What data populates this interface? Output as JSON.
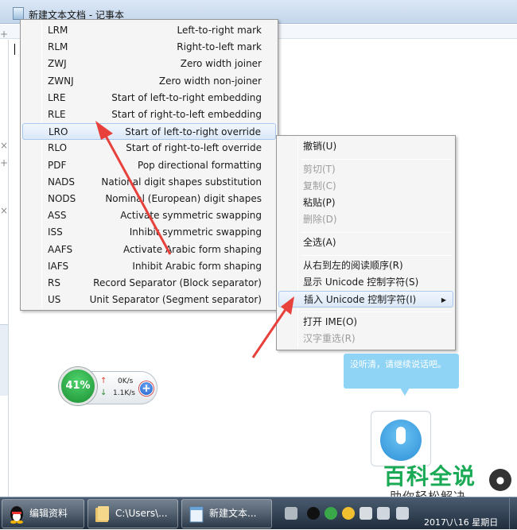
{
  "window": {
    "title": "新建文本文档 - 记事本"
  },
  "submenu": {
    "items": [
      {
        "abbr": "LRM",
        "desc": "Left-to-right mark"
      },
      {
        "abbr": "RLM",
        "desc": "Right-to-left mark"
      },
      {
        "abbr": "ZWJ",
        "desc": "Zero width joiner"
      },
      {
        "abbr": "ZWNJ",
        "desc": "Zero width non-joiner"
      },
      {
        "abbr": "LRE",
        "desc": "Start of left-to-right embedding"
      },
      {
        "abbr": "RLE",
        "desc": "Start of right-to-left embedding"
      },
      {
        "abbr": "LRO",
        "desc": "Start of left-to-right override",
        "highlighted": true
      },
      {
        "abbr": "RLO",
        "desc": "Start of right-to-left override"
      },
      {
        "abbr": "PDF",
        "desc": "Pop directional formatting"
      },
      {
        "abbr": "NADS",
        "desc": "National digit shapes substitution"
      },
      {
        "abbr": "NODS",
        "desc": "Nominal (European) digit shapes"
      },
      {
        "abbr": "ASS",
        "desc": "Activate symmetric swapping"
      },
      {
        "abbr": "ISS",
        "desc": "Inhibit symmetric swapping"
      },
      {
        "abbr": "AAFS",
        "desc": "Activate Arabic form shaping"
      },
      {
        "abbr": "IAFS",
        "desc": "Inhibit Arabic form shaping"
      },
      {
        "abbr": "RS",
        "desc": "Record Separator (Block separator)"
      },
      {
        "abbr": "US",
        "desc": "Unit Separator (Segment separator)"
      }
    ]
  },
  "context_menu": {
    "undo": "撤销(U)",
    "cut": "剪切(T)",
    "copy": "复制(C)",
    "paste": "粘贴(P)",
    "delete": "删除(D)",
    "select_all": "全选(A)",
    "rtl_reading": "从右到左的阅读顺序(R)",
    "show_unicode": "显示 Unicode 控制字符(S)",
    "insert_unicode": "插入 Unicode 控制字符(I)",
    "open_ime": "打开 IME(O)",
    "reconversion": "汉字重选(R)"
  },
  "net_widget": {
    "percent": "41%",
    "upload": "0K/s",
    "download": "1.1K/s"
  },
  "voice": {
    "bubble_text": "没听清，请继续说话吧。"
  },
  "watermark": {
    "main": "百科全说",
    "sub": "助你轻松解决"
  },
  "taskbar": {
    "buttons": [
      {
        "label": "编辑资料"
      },
      {
        "label": "C:\\Users\\..."
      },
      {
        "label": "新建文本..."
      }
    ],
    "clock_date": "2017\\八16 星期日"
  },
  "colors": {
    "arrow_red": "#e8403a",
    "highlight_border": "#a8c8ec",
    "watermark_green": "#1aaa55",
    "bubble_blue": "#8fd3f5"
  }
}
